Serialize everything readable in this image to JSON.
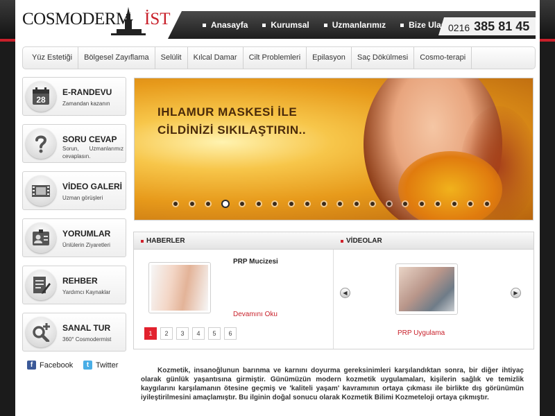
{
  "brand": {
    "logo_main": "COSMODERM",
    "logo_accent": "İST"
  },
  "top_nav": {
    "items": [
      "Anasayfa",
      "Kurumsal",
      "Uzmanlarımız",
      "Bize Ulaşın"
    ]
  },
  "phone": {
    "area": "0216",
    "number": "385 81 45"
  },
  "categories": [
    "Yüz Estetiği",
    "Bölgesel Zayıflama",
    "Selülit",
    "Kılcal Damar",
    "Cilt Problemleri",
    "Epilasyon",
    "Saç Dökülmesi",
    "Cosmo-terapi"
  ],
  "sidebar": [
    {
      "title": "E-RANDEVU",
      "subtitle": "Zamandan kazanın",
      "icon": "calendar-icon",
      "calendar_day": "28"
    },
    {
      "title": "SORU CEVAP",
      "subtitle": "Sorun, Uzmanlarımız cevaplasın.",
      "icon": "question-icon"
    },
    {
      "title": "VİDEO GALERİ",
      "subtitle": "Uzman görüşleri",
      "icon": "film-icon"
    },
    {
      "title": "YORUMLAR",
      "subtitle": "Ünlülerin Ziyaretleri",
      "icon": "id-badge-icon"
    },
    {
      "title": "REHBER",
      "subtitle": "Yardımcı Kaynaklar",
      "icon": "document-pen-icon"
    },
    {
      "title": "SANAL TUR",
      "subtitle": "360° Cosmodermist",
      "icon": "magnifier-plus-icon"
    }
  ],
  "social": {
    "facebook": "Facebook",
    "twitter": "Twitter"
  },
  "slider": {
    "headline_line1": "IHLAMUR MASKESİ İLE",
    "headline_line2": "CİLDİNİZİ SIKILAŞTIRIN..",
    "dot_count": 20,
    "active_dot": 4
  },
  "news": {
    "header": "HABERLER",
    "item_title": "PRP Mucizesi",
    "more_label": "Devamını Oku",
    "pages": [
      "1",
      "2",
      "3",
      "4",
      "5",
      "6"
    ],
    "active_page": "1"
  },
  "videos": {
    "header": "VİDEOLAR",
    "item_title": "PRP Uygulama"
  },
  "intro": "Kozmetik, insanoğlunun barınma ve karnını doyurma gereksinimleri karşılandıktan sonra,  bir diğer ihtiyaç olarak günlük yaşantısına girmiştir. Günümüzün modern kozmetik uygulamaları, kişilerin sağlık ve temizlik kaygılarını karşılamanın ötesine geçmiş ve 'kaliteli yaşam' kavramının ortaya çıkması ile birlikte dış görünümün iyileştirilmesini amaçlamıştır. Bu ilginin doğal sonucu olarak Kozmetik Bilimi Kozmeteloji ortaya çıkmıştır."
}
